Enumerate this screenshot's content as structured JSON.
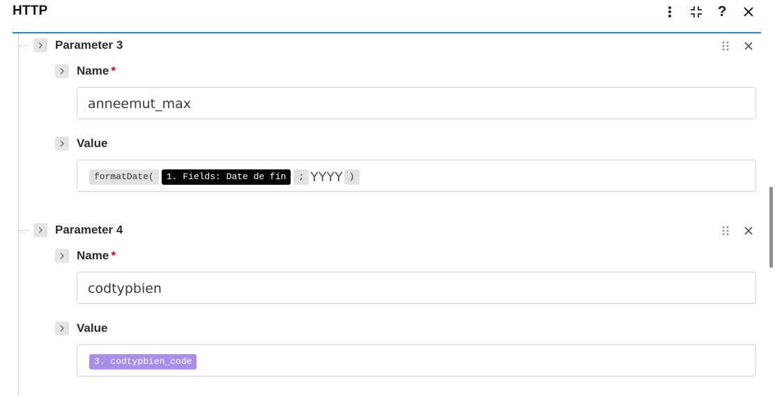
{
  "header": {
    "title": "HTTP",
    "icons": [
      "more-vertical-icon",
      "collapse-icon",
      "help-icon",
      "close-icon"
    ],
    "help_glyph": "?"
  },
  "accent_color": "#2a84c6",
  "parameters": [
    {
      "title": "Parameter 3",
      "name_label": "Name",
      "required_mark": "*",
      "name_value": "anneemut_max",
      "value_label": "Value",
      "value_tokens": [
        {
          "kind": "function",
          "text": "formatDate("
        },
        {
          "kind": "field",
          "text": "1. Fields: Date de fin"
        },
        {
          "kind": "separator",
          "text": ";"
        },
        {
          "kind": "text",
          "text": "YYYY"
        },
        {
          "kind": "close",
          "text": ")"
        }
      ]
    },
    {
      "title": "Parameter 4",
      "name_label": "Name",
      "required_mark": "*",
      "name_value": "codtypbien",
      "value_label": "Value",
      "value_tokens": [
        {
          "kind": "variable",
          "text": "3. codtypbien_code",
          "color": "#a88ee9"
        }
      ]
    }
  ]
}
